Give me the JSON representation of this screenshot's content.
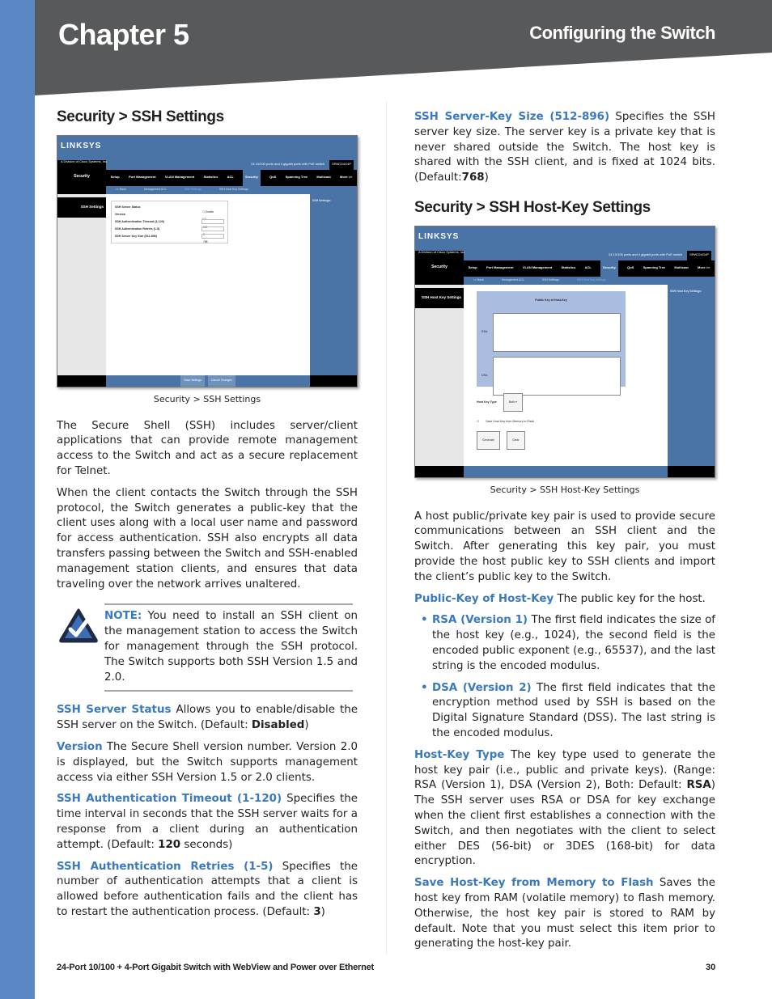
{
  "header": {
    "chapter": "Chapter 5",
    "section": "Configuring the Switch"
  },
  "colors": {
    "accent_blue": "#3a78bf",
    "side_bar": "#5b87c5",
    "header_band": "#58595b"
  },
  "left": {
    "heading": "Security > SSH Settings",
    "screenshot": {
      "logo": "LINKSYS",
      "logo_sub": "A Division of Cisco Systems, Inc.",
      "section": "Security",
      "banner": "24 10/100 ports and 4 gigabit ports with PoE switch",
      "model": "SRW224G4P",
      "tabs": [
        "Setup",
        "Port Management",
        "VLAN Management",
        "Statistics",
        "ACL",
        "Security",
        "QoS",
        "Spanning Tree",
        "Multicast",
        "More >>"
      ],
      "active_tab": "Security",
      "subtabs": [
        "<< Back",
        "Management ACL",
        "SSH Settings",
        "SSH Host Key Settings"
      ],
      "side_label": "SSH Settings",
      "fields": [
        {
          "label": "SSH Server Status",
          "value": "Enable"
        },
        {
          "label": "Version",
          "value": "2.0"
        },
        {
          "label": "SSH Authentication Timeout (1-120)",
          "value": "120",
          "unit": "seconds"
        },
        {
          "label": "SSH Authentication Retries (1-5)",
          "value": "3"
        },
        {
          "label": "SSH Server Key Size (512-896)",
          "value": "768"
        }
      ],
      "help_title": "SSH Settings:",
      "buttons": [
        "Save Settings",
        "Cancel Changes"
      ]
    },
    "caption": "Security > SSH Settings",
    "para1": "The Secure Shell (SSH) includes server/client applications that can provide remote management access to the Switch and act as a secure replacement for Telnet.",
    "para2": "When the client contacts the Switch through the SSH protocol, the Switch generates a public-key that the client uses along with a local user name and password for access authentication. SSH also encrypts all data transfers passing between the Switch and SSH-enabled management station clients, and ensures that data traveling over the network arrives unaltered.",
    "note": {
      "label": "NOTE:",
      "text": " You need to install an SSH client on the management station to access the Switch for management through the SSH protocol. The Switch supports both SSH Version 1.5 and 2.0."
    },
    "defs": [
      {
        "term": "SSH Server Status",
        "pre": "  Allows you to enable/disable the SSH server on the Switch. (Default: ",
        "bold": "Disabled",
        "post": ")"
      },
      {
        "term": "Version",
        "pre": "  The Secure Shell version number. Version 2.0 is displayed, but the Switch supports management access via either SSH Version 1.5 or 2.0 clients.",
        "bold": "",
        "post": ""
      },
      {
        "term": "SSH Authentication Timeout (1-120)",
        "pre": "  Specifies the time interval in seconds that the SSH server waits for a response from a client during an authentication attempt. (Default: ",
        "bold": "120",
        "post": " seconds)"
      },
      {
        "term": "SSH Authentication Retries (1-5)",
        "pre": "  Specifies the number of authentication attempts that a client is allowed before authentication fails and the client has to restart the authentication process. (Default: ",
        "bold": "3",
        "post": ")"
      }
    ]
  },
  "right": {
    "def_keysize": {
      "term": "SSH Server-Key Size (512-896)",
      "pre": "  Specifies the SSH server key size. The server key is a private key that is never shared outside the Switch. The host key is shared with the SSH client, and is fixed at 1024 bits. (Default:",
      "bold": "768",
      "post": ")"
    },
    "heading": "Security > SSH Host-Key Settings",
    "screenshot": {
      "side_label": "SSH Host Key Settings",
      "subtabs": [
        "<< Back",
        "Management ACL",
        "SSH Settings",
        "SSH Host Key Settings"
      ],
      "box_title": "Public Key of Host-Key",
      "rsa_label": "RSA",
      "dsa_label": "DSA",
      "host_key_type_label": "Host Key Type",
      "host_key_type_value": "Both",
      "save_checkbox_label": "Save Host-Key from Memory to Flash",
      "buttons": [
        "Generate",
        "Clear"
      ],
      "help_title": "SSH Host Key Settings:"
    },
    "caption": "Security > SSH Host-Key Settings",
    "para1": "A host public/private key pair is used to provide secure communications between an SSH client and the Switch. After generating this key pair, you must provide the host public key to SSH clients and import the client’s public key to the Switch.",
    "def_pubkey": {
      "term": "Public-Key of Host-Key",
      "pre": "  The public key for the host.",
      "bold": "",
      "post": ""
    },
    "bullets": [
      {
        "term": "RSA (Version 1)",
        "text": "  The first field indicates the size of the host key (e.g., 1024), the second field is the encoded public exponent (e.g., 65537), and the last string is the encoded modulus."
      },
      {
        "term": "DSA (Version 2)",
        "text": " The first field indicates that the encryption method used by SSH is based on the Digital Signature Standard (DSS). The last string is the encoded modulus."
      }
    ],
    "def_hostkeytype": {
      "term": "Host-Key Type",
      "pre": " The key type used to generate the host key pair (i.e., public and private keys). (Range: RSA (Version 1), DSA (Version 2), Both: Default: ",
      "bold": "RSA",
      "post": ") The SSH server uses RSA or DSA for key exchange when the client first establishes a connection with the Switch, and then negotiates with the client to select either DES (56-bit) or 3DES (168-bit) for data encryption."
    },
    "def_save": {
      "term": "Save Host-Key from Memory to Flash",
      "pre": "  Saves the host key from RAM (volatile memory) to flash memory. Otherwise, the host key pair is stored to RAM by default. Note that you must select this item prior to generating the host-key pair.",
      "bold": "",
      "post": ""
    }
  },
  "footer": {
    "product": "24-Port 10/100 + 4-Port Gigabit Switch with WebView and Power over Ethernet",
    "page": "30"
  }
}
